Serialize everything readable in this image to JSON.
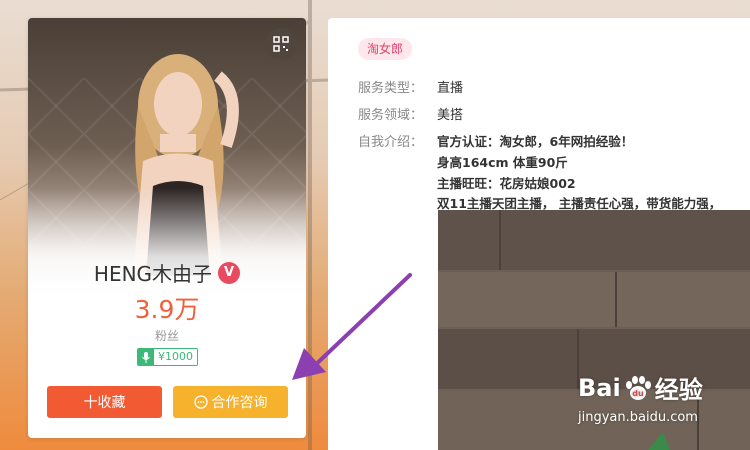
{
  "profile": {
    "name": "HENG木由子",
    "verified_mark": "V",
    "fans_count": "3.9万",
    "fans_label": "粉丝",
    "price": "¥1000",
    "favorite_button": "十收藏",
    "consult_button": "合作咨询"
  },
  "detail": {
    "org_tag": "淘女郎",
    "fields": [
      {
        "label": "服务类型：",
        "value": "直播"
      },
      {
        "label": "服务领域：",
        "value": "美搭"
      }
    ],
    "intro_label": "自我介绍：",
    "intro_lines": [
      "官方认证：淘女郎，6年网拍经验！",
      "身高164cm 体重90斤",
      "主播旺旺：花房姑娘002",
      "双11主播天团主播， 主播责任心强，带货能力强，"
    ]
  },
  "watermark": {
    "brand": "Bai",
    "brand_suffix": "经验",
    "url": "jingyan.baidu.com"
  },
  "colors": {
    "accent_red": "#f25a34",
    "accent_yellow": "#f6b12d",
    "price_green": "#3cb878",
    "verified_pink": "#e84a5f",
    "arrow_purple": "#8b3fb0"
  },
  "icons": [
    "qr-code-icon",
    "verified-icon",
    "mic-icon",
    "chat-bubble-icon",
    "baidu-paw-icon",
    "annotation-arrow-icon"
  ]
}
